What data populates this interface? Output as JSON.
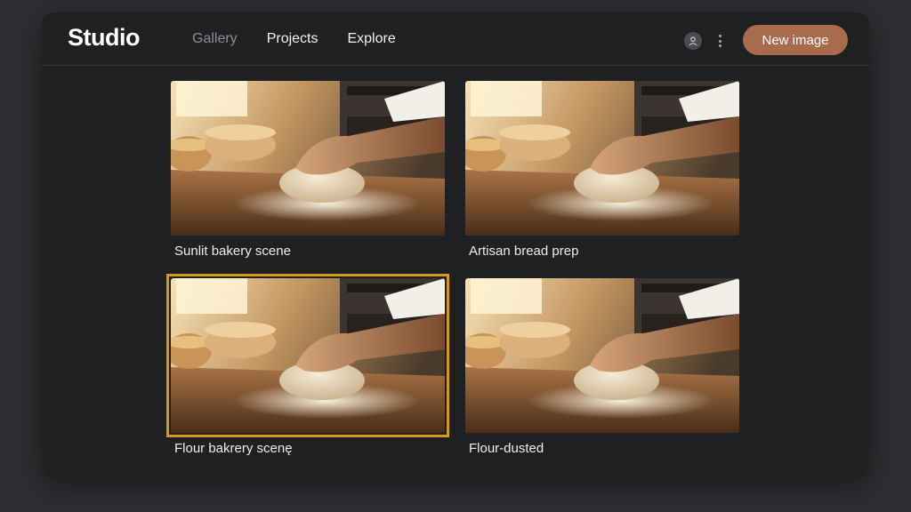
{
  "app": {
    "logo": "Studio"
  },
  "nav": [
    {
      "label": "Gallery",
      "state": "inactive"
    },
    {
      "label": "Projects",
      "state": "active"
    },
    {
      "label": "Explore",
      "state": "active"
    }
  ],
  "header": {
    "account_icon": "user-icon",
    "more_icon": "kebab-menu-icon",
    "new_button": "New image"
  },
  "colors": {
    "accent": "#a86b4c",
    "selection": "#d79a16"
  },
  "gallery": {
    "items": [
      {
        "caption": "Sunlit bakery scene",
        "selected": false
      },
      {
        "caption": "Artisan bread prep",
        "selected": false
      },
      {
        "caption": "Flour bakrery scenę",
        "selected": true
      },
      {
        "caption": "Flour-dusted",
        "selected": false
      }
    ]
  }
}
